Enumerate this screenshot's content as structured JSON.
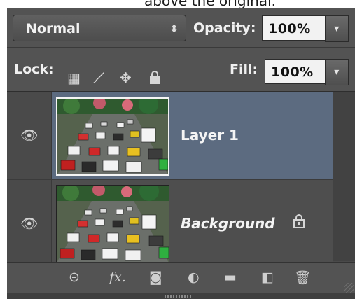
{
  "caption": "above the original.",
  "blend": {
    "mode": "Normal"
  },
  "opacity": {
    "label": "Opacity:",
    "value": "100%"
  },
  "lock": {
    "label": "Lock:"
  },
  "fill": {
    "label": "Fill:",
    "value": "100%"
  },
  "layers": [
    {
      "name": "Layer 1",
      "selected": true
    },
    {
      "name": "Background",
      "locked": true
    }
  ],
  "bottom_bar": {
    "fx_label": "fx"
  },
  "colors": {
    "panel": "#4a4a4a",
    "selected_layer": "#5c6b80",
    "input_bg": "#f2f2f2"
  }
}
